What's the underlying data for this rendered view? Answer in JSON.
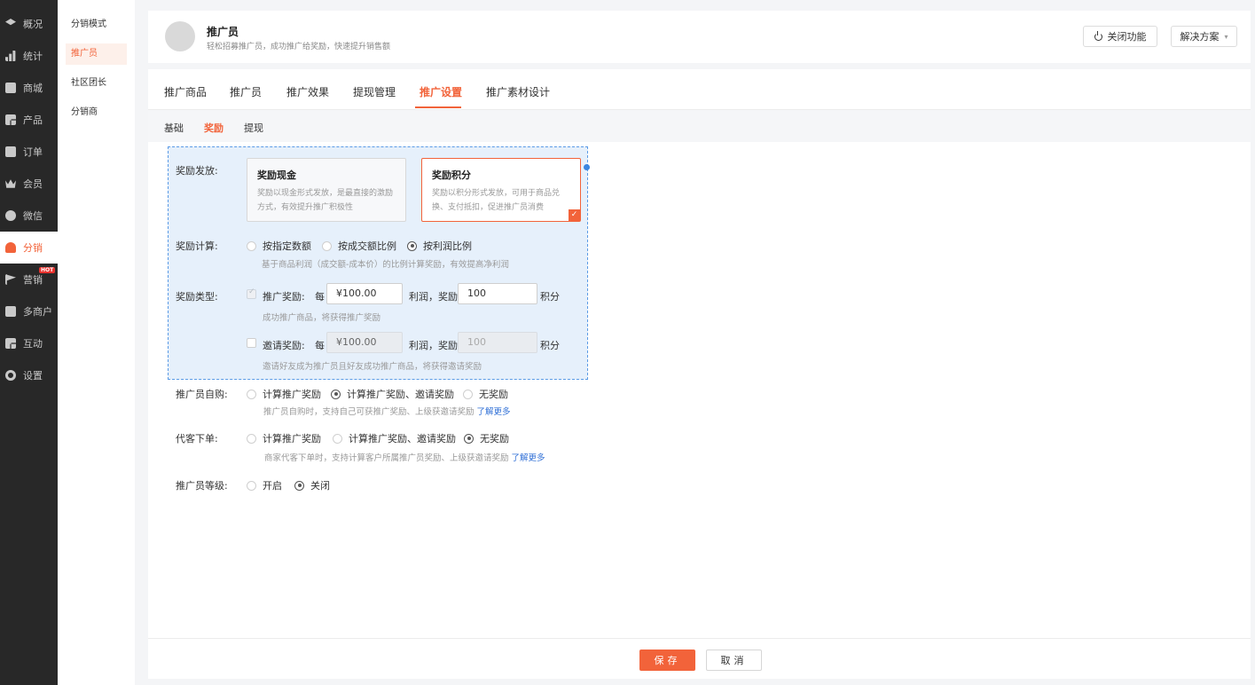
{
  "primary_nav": [
    {
      "label": "概况",
      "icon": "layers-icon"
    },
    {
      "label": "统计",
      "icon": "bar-chart-icon"
    },
    {
      "label": "商城",
      "icon": "store-icon"
    },
    {
      "label": "产品",
      "icon": "grid-icon"
    },
    {
      "label": "订单",
      "icon": "order-icon"
    },
    {
      "label": "会员",
      "icon": "crown-icon"
    },
    {
      "label": "微信",
      "icon": "wechat-icon"
    },
    {
      "label": "分销",
      "icon": "distribution-icon"
    },
    {
      "label": "营销",
      "icon": "flag-icon",
      "badge": "HOT"
    },
    {
      "label": "多商户",
      "icon": "multi-shop-icon"
    },
    {
      "label": "互动",
      "icon": "interact-icon"
    },
    {
      "label": "设置",
      "icon": "gear-icon"
    }
  ],
  "secondary_nav": [
    "分销模式",
    "推广员",
    "社区团长",
    "分销商"
  ],
  "header": {
    "title": "推广员",
    "subtitle": "轻松招募推广员，成功推广给奖励，快速提升销售额",
    "close_btn": "关闭功能",
    "solution_btn": "解决方案"
  },
  "tabs": [
    "推广商品",
    "推广员",
    "推广效果",
    "提现管理",
    "推广设置",
    "推广素材设计"
  ],
  "subtabs": [
    "基础",
    "奖励",
    "提现"
  ],
  "form": {
    "reward_issue": {
      "label": "奖励发放:",
      "cards": [
        {
          "title": "奖励现金",
          "desc": "奖励以现金形式发放，是最直接的激励方式，有效提升推广积极性"
        },
        {
          "title": "奖励积分",
          "desc": "奖励以积分形式发放，可用于商品兑换、支付抵扣，促进推广员消费"
        }
      ]
    },
    "reward_calc": {
      "label": "奖励计算:",
      "options": [
        "按指定数额",
        "按成交额比例",
        "按利润比例"
      ],
      "hint": "基于商品利润（成交额-成本价）的比例计算奖励，有效提高净利润"
    },
    "reward_type": {
      "label": "奖励类型:",
      "promo": {
        "name": "推广奖励:",
        "per": "每",
        "amount": "¥100.00",
        "mid": "利润，奖励",
        "points": "100",
        "unit": "积分",
        "hint": "成功推广商品，将获得推广奖励"
      },
      "invite": {
        "name": "邀请奖励:",
        "per": "每",
        "amount": "¥100.00",
        "mid": "利润，奖励",
        "points": "100",
        "unit": "积分",
        "hint": "邀请好友成为推广员且好友成功推广商品，将获得邀请奖励"
      }
    },
    "self_buy": {
      "label": "推广员自购:",
      "options": [
        "计算推广奖励",
        "计算推广奖励、邀请奖励",
        "无奖励"
      ],
      "hint": "推广员自购时，支持自己可获推广奖励、上级获邀请奖励",
      "link": "了解更多"
    },
    "proxy_order": {
      "label": "代客下单:",
      "options": [
        "计算推广奖励",
        "计算推广奖励、邀请奖励",
        "无奖励"
      ],
      "hint": "商家代客下单时，支持计算客户所属推广员奖励、上级获邀请奖励",
      "link": "了解更多"
    },
    "level": {
      "label": "推广员等级:",
      "options": [
        "开启",
        "关闭"
      ]
    }
  },
  "footer": {
    "save": "保存",
    "cancel": "取消"
  },
  "colors": {
    "accent": "#f2633a",
    "sidebar": "#282828",
    "link": "#2f6fd6",
    "selection": "#e6f0fb"
  }
}
